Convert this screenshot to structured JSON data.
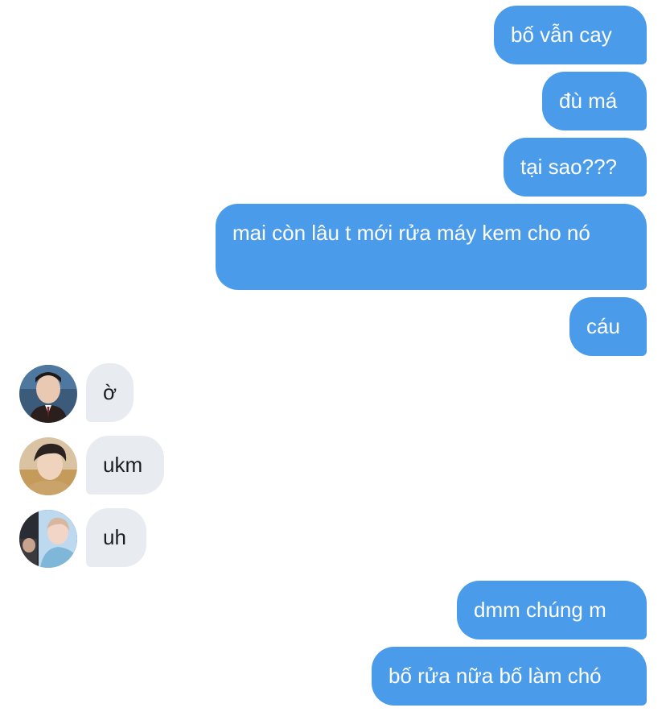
{
  "messages": {
    "sent_1": "bố vẫn cay",
    "sent_2": "đù má",
    "sent_3": "tại sao???",
    "sent_4": "mai còn lâu t mới rửa máy kem cho nó",
    "sent_5": "cáu",
    "recv_1": "ờ",
    "recv_2": "ukm",
    "recv_3": "uh",
    "sent_6": "dmm chúng m",
    "sent_7": "bố rửa nữa bố làm chó"
  },
  "colors": {
    "sent_bubble": "#4a9bea",
    "received_bubble": "#e8ebef",
    "background": "#ffffff"
  }
}
